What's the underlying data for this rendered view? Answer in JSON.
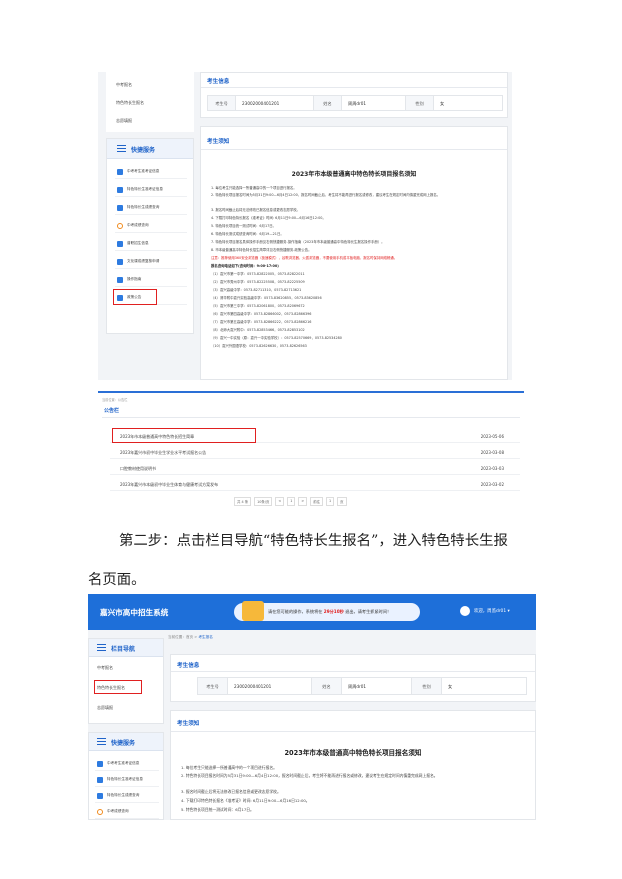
{
  "shot1": {
    "side_links": [
      "中考报名",
      "特色特长生报名",
      "志愿填报"
    ],
    "quick_services": {
      "title": "快捷服务",
      "items": [
        "中考考生准考证信息",
        "特色特长生准考证信息",
        "特色特长生成绩查询",
        "中考成绩查询",
        "普职招生信息",
        "文化课成绩复核申请",
        "操作指南",
        "政策公告"
      ]
    },
    "exam_info": {
      "title": "考生信息",
      "labels": [
        "考生号",
        "姓名",
        "性别"
      ],
      "values": [
        "23002000401201",
        "周周dr01",
        "女"
      ]
    },
    "notice": {
      "section_title": "考生须知",
      "heading": "2023年市本级普通高中特色特长项目报名须知",
      "lines": [
        "1. 每位考生只能选择一所普通高中的一个项目进行报名。",
        "2. 特色特长项目报名时间为5月31日9:00—6月4日12:00，报名时间截止后，考生将不能再进行报名或修改，建议考生在规定时间内慎重完成网上报名。",
        "3. 报名时间截止后将无法修改已报名信息或更改志愿学校。",
        "4. 下载打印特色特长报名《准考证》时间: 6月11日9:00—6月16日12:00。",
        "5. 特色特长项目统一测试时间：6月17日。",
        "6. 特色特长测试成绩查询时间：6月19—21日。",
        "7. 特色特长项目报名具体操作手册见右侧快捷服务-操作指南（2023年市本级普通高中特色特长生报名操作手册）。",
        "8. 市本级普通高中特色特长招生简章详见右侧快捷服务-政策公告。",
        "注意：推荐使用360安全浏览器（极速模式），谷歌浏览器，火狐浏览器，不要使用手机或平板电脑，报名时保持网络畅通。",
        "报名咨询电话如下(咨询时间：9:00-17:00)",
        "（1）嘉兴市第一中学：0573-82822005，0573-82822011",
        "（2）嘉兴市秀州中学：0573-82225508，0573-82225509",
        "（3）嘉兴高级中学：0573-82711310，0573-82713621",
        "（4）清华附中嘉兴实验高级中学：0573-83620855，0573-83620856",
        "（5）嘉兴市第三中学：0573-82061800，0573-82069672",
        "（6）嘉兴市第四高级中学：0573-82866002，0573-82866396",
        "（7）嘉兴市第五高级中学：0573-82866222，0573-82866216",
        "（8）北师大嘉兴附中：0573-82853466，0573-82853102",
        "（9）嘉兴一中实验（原：嘉兴一中实验学校）：0573-82570669，0573-82534280",
        "（10）嘉兴外国语学校：0573-82626630，0573-82626563"
      ]
    }
  },
  "shot2": {
    "breadcrumb": "当前位置：公告栏",
    "title": "公告栏",
    "rows": [
      {
        "text": "2023年市本级普通高中特色特长招生简章",
        "date": "2023-05-06"
      },
      {
        "text": "2023年嘉兴市初中毕业生学业水平考试报名公告",
        "date": "2023-03-08"
      },
      {
        "text": "口腔教材使用说明书",
        "date": "2023-03-03"
      },
      {
        "text": "2023年嘉兴市本级初中毕业生体育与健康考试方案发布",
        "date": "2023-03-02"
      }
    ],
    "pager": [
      "共 4 条",
      "10条/页",
      "<",
      "1",
      ">",
      "前往",
      "1",
      "页"
    ]
  },
  "paragraph": {
    "line1": "第二步：点击栏目导航“特色特长生报名”，进入特色特长生报",
    "line2": "名页面。"
  },
  "shot3": {
    "brand": "嘉兴市高中招生系统",
    "timer_prefix": "请在您可能的操作，系统将在",
    "timer_value": "29分10秒",
    "timer_suffix": "退出，请考生抓紧时间！",
    "user": "欢迎，周监dr01 ▾",
    "breadcrumb_prefix": "当前位置：首页 >",
    "breadcrumb_current": "考生报名",
    "nav": {
      "title": "栏目导航",
      "items": [
        "中考报名",
        "特色特长生报名",
        "志愿填报"
      ]
    },
    "quick_services": {
      "title": "快捷服务",
      "items": [
        "中考考生准考证信息",
        "特色特长生准考证信息",
        "特色特长生成绩查询",
        "中考成绩查询"
      ]
    },
    "exam_info": {
      "title": "考生信息",
      "labels": [
        "考生号",
        "姓名",
        "性别"
      ],
      "values": [
        "23002000401201",
        "周周dr01",
        "女"
      ]
    },
    "notice": {
      "section_title": "考生须知",
      "heading": "2023年市本级普通高中特色特长项目报名须知",
      "lines": [
        "1. 每位考生只能选择一所普通高中的一个项目进行报名。",
        "2. 特色特长项目报名时间为5月31日9:00—6月4日12:00，报名时间截止后，考生将不能再进行报名或修改，建议考生在规定时间内慎重完成网上报名。",
        "3. 报名时间截止后将无法修改已报名信息或更改志愿学校。",
        "4. 下载打印特色特长报名《准考证》时间: 6月11日9:00—6月16日12:00。",
        "5. 特色特长项目统一测试时间：6月17日。"
      ]
    }
  }
}
